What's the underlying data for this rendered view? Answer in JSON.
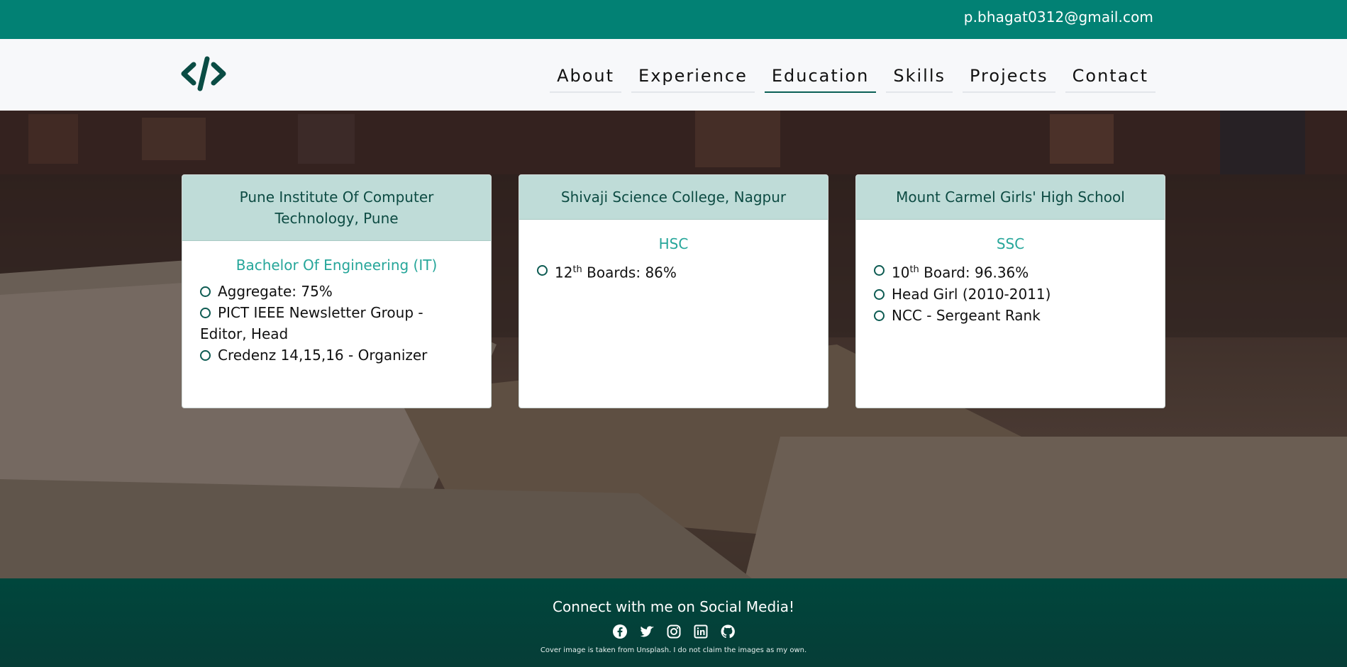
{
  "topbar": {
    "email": "p.bhagat0312@gmail.com"
  },
  "nav": {
    "items": [
      {
        "label": "About"
      },
      {
        "label": "Experience"
      },
      {
        "label": "Education",
        "active": true
      },
      {
        "label": "Skills"
      },
      {
        "label": "Projects"
      },
      {
        "label": "Contact"
      }
    ]
  },
  "education": [
    {
      "institution": "Pune Institute Of Computer Technology, Pune",
      "degree": "Bachelor Of Engineering (IT)",
      "items": [
        "Aggregate: 75%",
        "PICT IEEE Newsletter Group - Editor, Head",
        "Credenz 14,15,16 - Organizer"
      ]
    },
    {
      "institution": "Shivaji Science College, Nagpur",
      "degree": "HSC",
      "items": [
        {
          "num": "12",
          "sup": "th",
          "rest": " Boards: 86%"
        }
      ]
    },
    {
      "institution": "Mount Carmel Girls' High School",
      "degree": "SSC",
      "items": [
        {
          "num": "10",
          "sup": "th",
          "rest": " Board: 96.36%"
        },
        "Head Girl (2010-2011)",
        "NCC - Sergeant Rank"
      ]
    }
  ],
  "footer": {
    "title": "Connect with me on Social Media!",
    "icons": [
      "facebook-icon",
      "twitter-icon",
      "instagram-icon",
      "linkedin-icon",
      "github-icon"
    ],
    "note": "Cover image is taken from Unsplash. I do not claim the images as my own."
  },
  "colors": {
    "topbar": "#028174",
    "footer": "#00463c",
    "card_header": "#bfdcd8",
    "degree": "#26a69a"
  }
}
